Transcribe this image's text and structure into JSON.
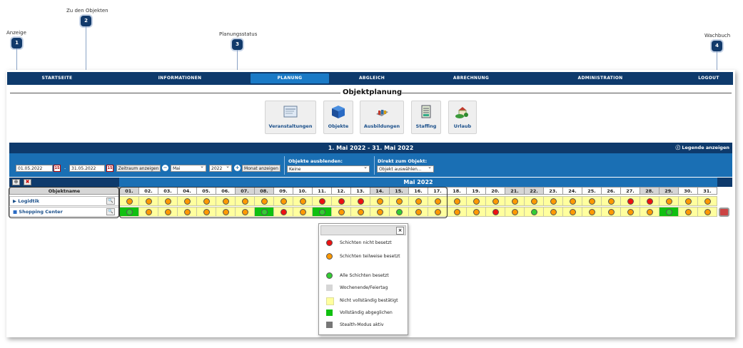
{
  "callouts": [
    {
      "number": "1",
      "label": "Anzeige"
    },
    {
      "number": "2",
      "label": "Zu den Objekten"
    },
    {
      "number": "3",
      "label": "Planungsstatus"
    },
    {
      "number": "4",
      "label": "Wachbuch"
    }
  ],
  "nav": {
    "items": [
      "STARTSEITE",
      "INFORMATIONEN",
      "PLANUNG",
      "ABGLEICH",
      "ABRECHNUNG",
      "ADMINISTRATION",
      "LOGOUT"
    ],
    "active": "PLANUNG"
  },
  "page_title": "Objektplanung",
  "tiles": [
    {
      "label": "Veranstaltungen",
      "icon": "events-icon"
    },
    {
      "label": "Objekte",
      "icon": "cube-icon"
    },
    {
      "label": "Ausbildungen",
      "icon": "books-icon"
    },
    {
      "label": "Staffing",
      "icon": "staffing-icon"
    },
    {
      "label": "Urlaub",
      "icon": "holiday-icon"
    }
  ],
  "range_title": "1. Mai 2022 - 31. Mai 2022",
  "legend_link": "Legende anzeigen",
  "filters": {
    "date_from": "01.05.2022",
    "date_to": "31.05.2022",
    "dash": "-",
    "zeitraum_button": "Zeitraum anzeigen",
    "month_value": "Mai",
    "year_value": "2022",
    "monat_button": "Monat anzeigen",
    "hide_label": "Objekte ausblenden:",
    "hide_value": "Keine",
    "direct_label": "Direkt zum Objekt:",
    "direct_value": "Objekt auswählen..."
  },
  "month_label": "Mai 2022",
  "grid": {
    "object_header": "Objektname",
    "days": [
      "01.",
      "02.",
      "03.",
      "04.",
      "05.",
      "06.",
      "07.",
      "08.",
      "09.",
      "10.",
      "11.",
      "12.",
      "13.",
      "14.",
      "15.",
      "16.",
      "17.",
      "18.",
      "19.",
      "20.",
      "21.",
      "22.",
      "23.",
      "24.",
      "25.",
      "26.",
      "27.",
      "28.",
      "29.",
      "30.",
      "31."
    ],
    "weekend_days": [
      1,
      7,
      8,
      14,
      15,
      21,
      22,
      28,
      29
    ],
    "rows": [
      {
        "name": "Logidtik",
        "prefix": "▶",
        "dots": [
          "o",
          "o",
          "o",
          "o",
          "o",
          "o",
          "o",
          "o",
          "o",
          "o",
          "r",
          "r",
          "r",
          "o",
          "o",
          "o",
          "o",
          "o",
          "o",
          "o",
          "o",
          "o",
          "o",
          "o",
          "o",
          "o",
          "r",
          "r",
          "o",
          "o",
          "o"
        ],
        "green_cells": []
      },
      {
        "name": "Shopping Center",
        "prefix": "",
        "dots": [
          "g",
          "o",
          "o",
          "o",
          "o",
          "o",
          "o",
          "g",
          "r",
          "o",
          "g",
          "o",
          "o",
          "o",
          "g",
          "o",
          "o",
          "o",
          "o",
          "r",
          "o",
          "g",
          "o",
          "o",
          "o",
          "o",
          "o",
          "o",
          "g",
          "o",
          "o"
        ],
        "green_cells": [
          1,
          8,
          11,
          29
        ]
      }
    ]
  },
  "legend": {
    "close": "×",
    "items": [
      {
        "label": "Schichten nicht besetzt",
        "color": "#e11",
        "shape": "round"
      },
      {
        "label": "Schichten teilweise besetzt",
        "color": "#ff9900",
        "shape": "round"
      },
      {
        "label": "Alle Schichten besetzt",
        "color": "#3c3",
        "shape": "round"
      },
      {
        "label": "Wochenende/Feiertag",
        "color": "#d6d6d6",
        "shape": "square"
      },
      {
        "label": "Nicht vollständig bestätigt",
        "color": "#ffff9e",
        "shape": "square"
      },
      {
        "label": "Vollständig abgeglichen",
        "color": "#10c010",
        "shape": "square"
      },
      {
        "label": "Stealth-Modus aktiv",
        "color": "#777777",
        "shape": "square"
      }
    ]
  }
}
